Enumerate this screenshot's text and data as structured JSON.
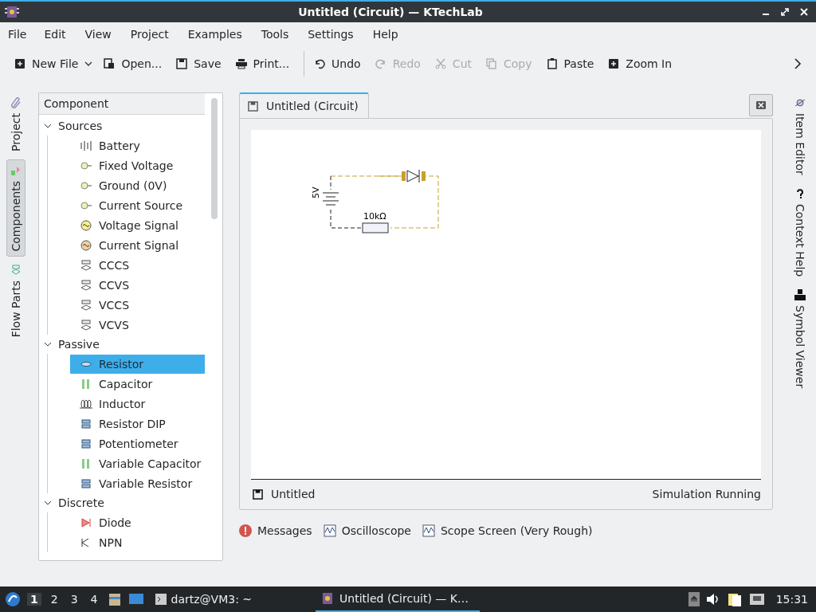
{
  "window": {
    "title": "Untitled (Circuit) — KTechLab"
  },
  "menu": [
    "File",
    "Edit",
    "View",
    "Project",
    "Examples",
    "Tools",
    "Settings",
    "Help"
  ],
  "toolbar": [
    {
      "label": "New File",
      "disabled": false
    },
    {
      "label": "Open...",
      "disabled": false
    },
    {
      "label": "Save",
      "disabled": false
    },
    {
      "label": "Print...",
      "disabled": false
    },
    {
      "label": "Undo",
      "disabled": false
    },
    {
      "label": "Redo",
      "disabled": true
    },
    {
      "label": "Cut",
      "disabled": true
    },
    {
      "label": "Copy",
      "disabled": true
    },
    {
      "label": "Paste",
      "disabled": false
    },
    {
      "label": "Zoom In",
      "disabled": false
    }
  ],
  "left_tabs": [
    {
      "label": "Project",
      "selected": false
    },
    {
      "label": "Components",
      "selected": true
    },
    {
      "label": "Flow Parts",
      "selected": false
    }
  ],
  "tree": {
    "header": "Component",
    "categories": [
      {
        "label": "Sources",
        "expanded": true,
        "children": [
          {
            "label": "Battery",
            "selected": false
          },
          {
            "label": "Fixed Voltage",
            "selected": false
          },
          {
            "label": "Ground (0V)",
            "selected": false
          },
          {
            "label": "Current Source",
            "selected": false
          },
          {
            "label": "Voltage Signal",
            "selected": false
          },
          {
            "label": "Current Signal",
            "selected": false
          },
          {
            "label": "CCCS",
            "selected": false
          },
          {
            "label": "CCVS",
            "selected": false
          },
          {
            "label": "VCCS",
            "selected": false
          },
          {
            "label": "VCVS",
            "selected": false
          }
        ]
      },
      {
        "label": "Passive",
        "expanded": true,
        "children": [
          {
            "label": "Resistor",
            "selected": true
          },
          {
            "label": "Capacitor",
            "selected": false
          },
          {
            "label": "Inductor",
            "selected": false
          },
          {
            "label": "Resistor DIP",
            "selected": false
          },
          {
            "label": "Potentiometer",
            "selected": false
          },
          {
            "label": "Variable Capacitor",
            "selected": false
          },
          {
            "label": "Variable Resistor",
            "selected": false
          }
        ]
      },
      {
        "label": "Discrete",
        "expanded": true,
        "children": [
          {
            "label": "Diode",
            "selected": false
          },
          {
            "label": "NPN",
            "selected": false
          }
        ]
      }
    ]
  },
  "editor": {
    "tabs": [
      {
        "label": "Untitled (Circuit)",
        "selected": true
      }
    ],
    "circuit": {
      "battery_label": "5V",
      "resistor_label": "10kΩ"
    },
    "status": {
      "file": "Untitled",
      "simulation": "Simulation Running"
    }
  },
  "right_tabs": [
    {
      "label": "Item Editor",
      "selected": false
    },
    {
      "label": "Context Help",
      "selected": false
    },
    {
      "label": "Symbol Viewer",
      "selected": false
    }
  ],
  "tool_views": [
    "Messages",
    "Oscilloscope",
    "Scope Screen (Very Rough)"
  ],
  "taskbar": {
    "workspaces": [
      {
        "label": "1",
        "selected": true
      },
      {
        "label": "2",
        "selected": false
      },
      {
        "label": "3",
        "selected": false
      },
      {
        "label": "4",
        "selected": false
      }
    ],
    "terminal": "dartz@VM3: ~",
    "window": "Untitled (Circuit) — K…",
    "clock": "15:31"
  }
}
